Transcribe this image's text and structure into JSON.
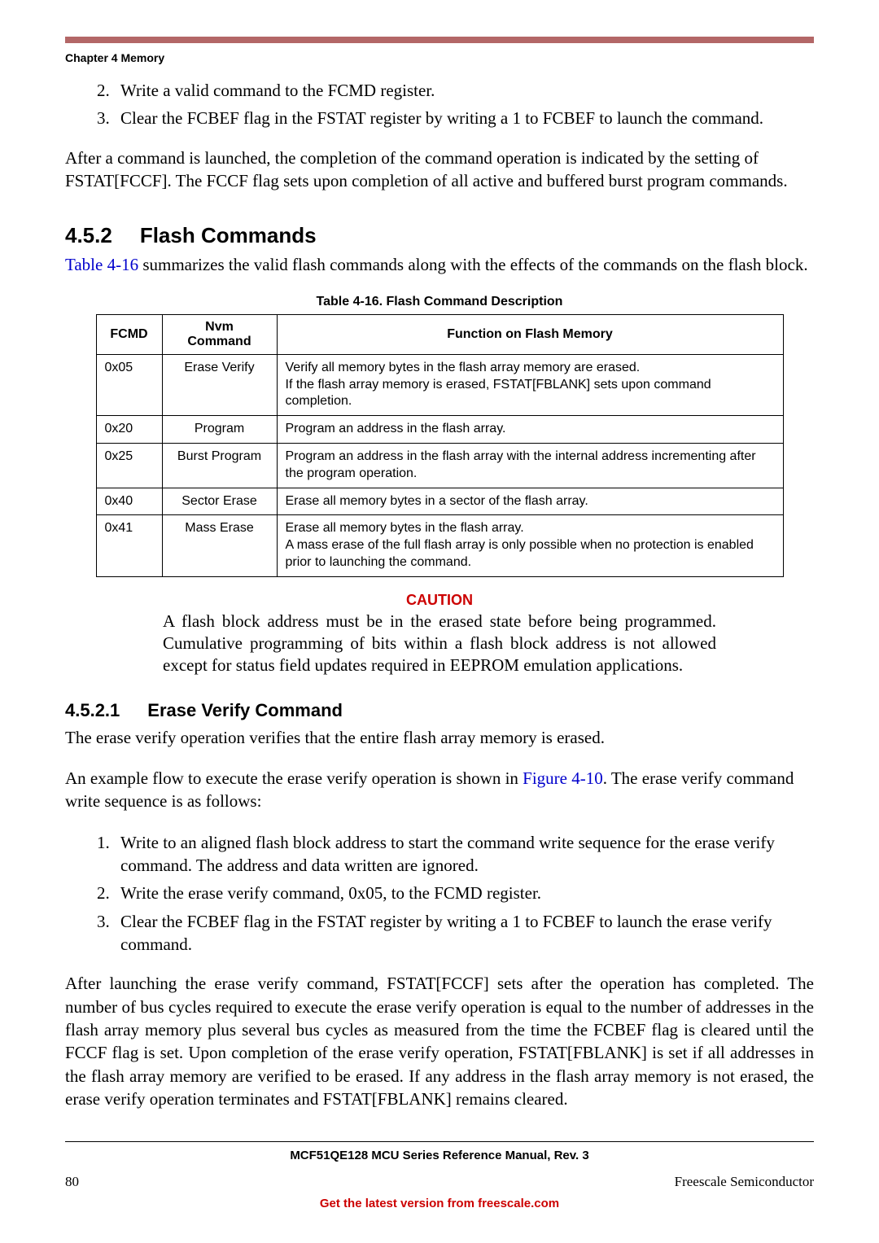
{
  "header": {
    "chapter_label": "Chapter 4 Memory"
  },
  "top_list": {
    "items": [
      "Write a valid command to the FCMD register.",
      "Clear the FCBEF flag in the FSTAT register by writing a 1 to FCBEF to launch the command."
    ]
  },
  "para_after_list": "After a command is launched, the completion of the command operation is indicated by the setting of FSTAT[FCCF]. The FCCF flag sets upon completion of all active and buffered burst program commands.",
  "section_452": {
    "number": "4.5.2",
    "title": "Flash Commands",
    "intro_a": "",
    "xref": "Table 4-16",
    "intro_b": " summarizes the valid flash commands along with the effects of the commands on the flash block."
  },
  "table": {
    "caption": "Table 4-16. Flash Command Description",
    "headers": {
      "fcmd": "FCMD",
      "nvm_a": "Nvm",
      "nvm_b": "Command",
      "func": "Function on Flash Memory"
    },
    "rows": [
      {
        "fcmd": "0x05",
        "nvm": "Erase Verify",
        "func": "Verify all memory bytes in the flash array memory are erased.\nIf the flash array memory is erased, FSTAT[FBLANK] sets upon command completion."
      },
      {
        "fcmd": "0x20",
        "nvm": "Program",
        "func": "Program an address in the flash array."
      },
      {
        "fcmd": "0x25",
        "nvm": "Burst Program",
        "func": "Program an address in the flash array with the internal address incrementing after the program operation."
      },
      {
        "fcmd": "0x40",
        "nvm": "Sector Erase",
        "func": "Erase all memory bytes in a sector of the flash array."
      },
      {
        "fcmd": "0x41",
        "nvm": "Mass Erase",
        "func": "Erase all memory bytes in the flash array.\nA mass erase of the full flash array is only possible when no protection is enabled prior to launching the command."
      }
    ]
  },
  "caution": {
    "label": "CAUTION",
    "body": "A flash block address must be in the erased state before being programmed. Cumulative programming of bits within a flash block address is not allowed except for status field updates required in EEPROM emulation applications."
  },
  "section_4521": {
    "number": "4.5.2.1",
    "title": "Erase Verify Command",
    "para1": "The erase verify operation verifies that the entire flash array memory is erased.",
    "para2_a": "An example flow to execute the erase verify operation is shown in ",
    "xref": "Figure 4-10",
    "para2_b": ". The erase verify command write sequence is as follows:",
    "steps": [
      "Write to an aligned flash block address to start the command write sequence for the erase verify command. The address and data written are ignored.",
      "Write the erase verify command, 0x05, to the FCMD register.",
      "Clear the FCBEF flag in the FSTAT register by writing a 1 to FCBEF to launch the erase verify command."
    ],
    "para3": "After launching the erase verify command, FSTAT[FCCF] sets after the operation has completed. The number of bus cycles required to execute the erase verify operation is equal to the number of addresses in the flash array memory plus several bus cycles as measured from the time the FCBEF flag is cleared until the FCCF flag is set. Upon completion of the erase verify operation, FSTAT[FBLANK] is set if all addresses in the flash array memory are verified to be erased. If any address in the flash array memory is not erased, the erase verify operation terminates and FSTAT[FBLANK] remains cleared."
  },
  "footer": {
    "doc_title": "MCF51QE128 MCU Series Reference Manual, Rev. 3",
    "page": "80",
    "company": "Freescale Semiconductor",
    "link": "Get the latest version from freescale.com"
  }
}
